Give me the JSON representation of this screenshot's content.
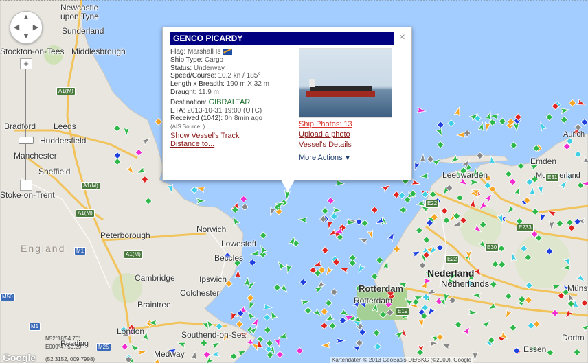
{
  "map": {
    "places": [
      {
        "key": "newcastle",
        "text": "Newcastle"
      },
      {
        "key": "upon_tyne",
        "text": "upon Tyne"
      },
      {
        "key": "sunderland",
        "text": "Sunderland"
      },
      {
        "key": "stockton",
        "text": "Stockton-on-Tees"
      },
      {
        "key": "middlesbrough",
        "text": "Middlesbrough"
      },
      {
        "key": "bradford",
        "text": "Bradford"
      },
      {
        "key": "leeds",
        "text": "Leeds"
      },
      {
        "key": "huddersfield",
        "text": "Huddersfield"
      },
      {
        "key": "manchester",
        "text": "Manchester"
      },
      {
        "key": "sheffield",
        "text": "Sheffield"
      },
      {
        "key": "stoke",
        "text": "Stoke-on-Trent"
      },
      {
        "key": "norwich",
        "text": "Norwich"
      },
      {
        "key": "lowestoft",
        "text": "Lowestoft"
      },
      {
        "key": "beccles",
        "text": "Beccles"
      },
      {
        "key": "peterborough",
        "text": "Peterborough"
      },
      {
        "key": "cambridge",
        "text": "Cambridge"
      },
      {
        "key": "ipswich",
        "text": "Ipswich"
      },
      {
        "key": "colchester",
        "text": "Colchester"
      },
      {
        "key": "braintree",
        "text": "Braintree"
      },
      {
        "key": "london",
        "text": "London"
      },
      {
        "key": "reading",
        "text": "Reading"
      },
      {
        "key": "southend",
        "text": "Southend-on-Sea"
      },
      {
        "key": "medway",
        "text": "Medway"
      },
      {
        "key": "rotterdam",
        "text": "Rotterdam"
      },
      {
        "key": "leeuwarden",
        "text": "Leeuwarden"
      },
      {
        "key": "emden",
        "text": "Emden"
      },
      {
        "key": "moormerland",
        "text": "Moormerland"
      },
      {
        "key": "essen",
        "text": "Essen"
      },
      {
        "key": "dortmund",
        "text": "Dortm"
      },
      {
        "key": "munster",
        "text": "Münster"
      },
      {
        "key": "aurich",
        "text": "Aurich"
      },
      {
        "key": "nederland",
        "text": "Nederland"
      },
      {
        "key": "netherlands",
        "text": "Netherlands"
      },
      {
        "key": "england",
        "text": "England"
      }
    ],
    "shields": [
      "A1(M)",
      "A1(M)",
      "A1(M)",
      "A1(M)",
      "M1",
      "M1",
      "M25",
      "E22",
      "E22",
      "E233",
      "E30",
      "E19",
      "E31",
      "M50"
    ],
    "coords_line1": "N52°18'54.70\"",
    "coords_line2": "E009°47'59.29\"",
    "coords_line3": "(52.3152, 009.7998)",
    "footer_text": "Kartendaten © 2013 GeoBasis-DE/BKG (©2009), Google",
    "google_logo": "Google"
  },
  "controls": {
    "zoom_in": "+",
    "zoom_out": "−"
  },
  "popup": {
    "title": "GENCO PICARDY",
    "close": "×",
    "flag_label": "Flag:",
    "flag_value": "Marshall Is",
    "ship_type_label": "Ship Type:",
    "ship_type_value": "Cargo",
    "status_label": "Status:",
    "status_value": "Underway",
    "speed_label": "Speed/Course:",
    "speed_value": "10.2 kn / 185°",
    "length_label": "Length x Breadth:",
    "length_value": "190 m X 32 m",
    "draught_label": "Draught:",
    "draught_value": "11.9 m",
    "destination_label": "Destination:",
    "destination_value": "GIBRALTAR",
    "eta_label": "ETA:",
    "eta_value": "2013-10-31 19:00 (UTC)",
    "received_label": "Received (1042):",
    "received_value": "0h 8min ago",
    "ais_source": "(AIS Source: )",
    "show_track": "Show Vessel's Track",
    "distance": "Distance to...",
    "ship_photos": "Ship Photos: 13",
    "upload_photo": "Upload a photo",
    "vessel_details": "Vessel's Details",
    "more_actions": "More Actions"
  }
}
